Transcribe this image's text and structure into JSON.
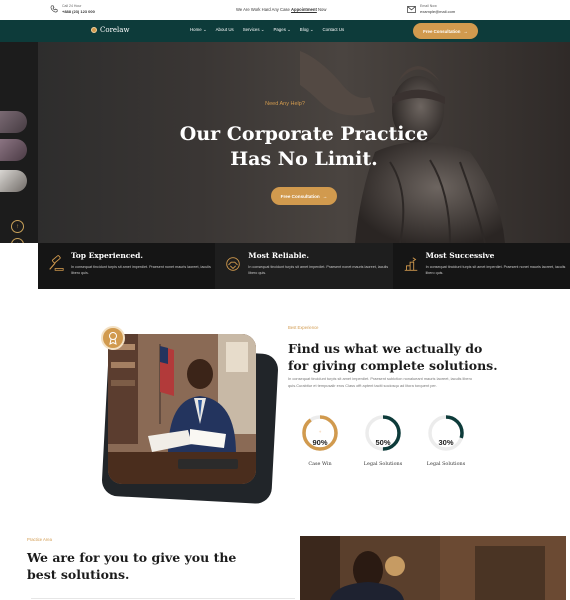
{
  "topbar": {
    "call_label": "Call 24 Hour",
    "call_number": "+888 (23) 123 000",
    "middle_text": "We Are Work Hard Any Case",
    "middle_link": "Appointment",
    "middle_after": "Now",
    "email_label": "Email Now",
    "email_value": "example@mail.com"
  },
  "nav": {
    "logo": "Corelaw",
    "items": [
      "Home",
      "About Us",
      "Services",
      "Pages",
      "Blog",
      "Contact Us"
    ],
    "cta": "Free Consultation"
  },
  "hero": {
    "kicker": "Need Any Help?",
    "title_line1": "Our Corporate Practice",
    "title_line2": "Has No Limit.",
    "cta": "Free Consultation"
  },
  "features": [
    {
      "title": "Top Experienced.",
      "text": "In consequat tincidunt turpis sit amet imperdiet. Praesent nonet mauris laoreet, iaculis libero quis."
    },
    {
      "title": "Most Reliable.",
      "text": "In consequat tincidunt turpis sit amet imperdiet. Praesent nonet mauris laoreet, iaculis libero quis."
    },
    {
      "title": "Most Successive",
      "text": "In consequat tincidunt turpis sit amet imperdiet. Praesent nonet mauris laoreet, iaculis libero quis."
    }
  ],
  "about": {
    "kicker": "Best Experience",
    "title": "Find us what we actually do for giving complete solutions.",
    "text": "In consequat tincidunt turpis sit amet imperdiet. Praesent sublction nonalueant mauris laoreet, iaculis libero quis.Curabitur et tempusalir eros Class offt aptent taciti sociosqu ad litora torquent per.",
    "stats": [
      {
        "value": 90,
        "label_value": "90%",
        "caption": "Case Win",
        "color": "#d19a4e"
      },
      {
        "value": 50,
        "label_value": "50%",
        "caption": "Legal Solutions",
        "color": "#0d3b3a"
      },
      {
        "value": 30,
        "label_value": "30%",
        "caption": "Legal Solutions",
        "color": "#0d3b3a"
      }
    ]
  },
  "practice": {
    "kicker": "Practice Area",
    "title": "We are for you to give you the best solutions."
  },
  "colors": {
    "accent": "#d19a4e",
    "dark_teal": "#0d3b3a"
  }
}
